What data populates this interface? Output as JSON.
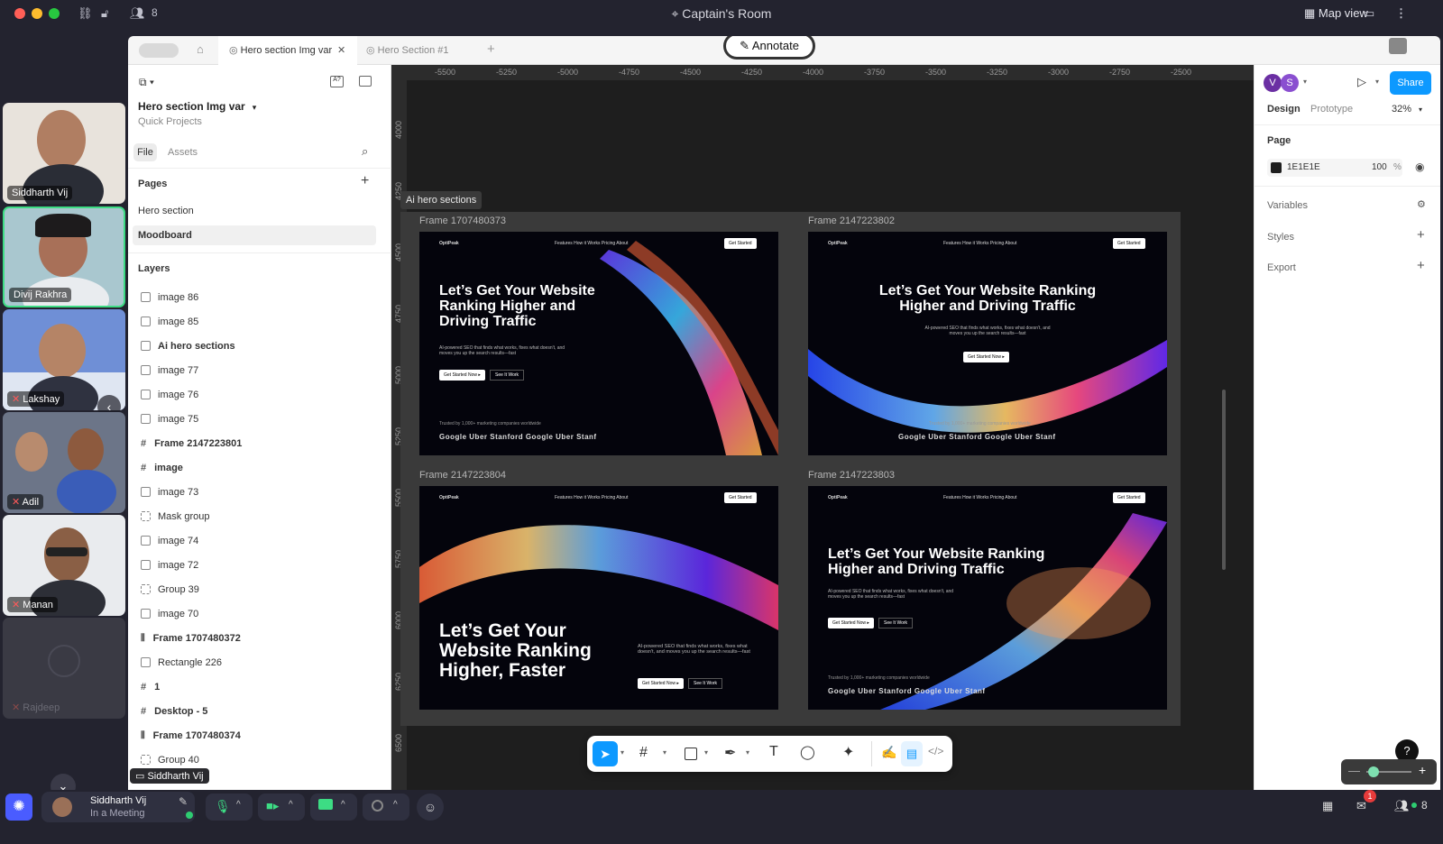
{
  "app": {
    "room_name": "Captain's Room",
    "participant_count": "8",
    "map_view_label": "Map view"
  },
  "participants": [
    {
      "name": "Siddharth Vij",
      "muted": false
    },
    {
      "name": "Divij Rakhra",
      "muted": false
    },
    {
      "name": "Lakshay",
      "muted": true
    },
    {
      "name": "Adil",
      "muted": true
    },
    {
      "name": "Manan",
      "muted": true
    },
    {
      "name": "Rajdeep",
      "muted": true
    }
  ],
  "tabs": [
    {
      "label": "Hero section Img var"
    },
    {
      "label": "Hero Section #1"
    }
  ],
  "annotate_label": "Annotate",
  "file": {
    "name": "Hero section Img var",
    "project": "Quick Projects",
    "tab_file": "File",
    "tab_assets": "Assets"
  },
  "pages": {
    "heading": "Pages",
    "items": [
      "Hero section",
      "Moodboard"
    ]
  },
  "layers": {
    "heading": "Layers",
    "items": [
      "image 86",
      "image 85",
      "Ai hero sections",
      "image 77",
      "image 76",
      "image 75",
      "Frame 2147223801",
      "image",
      "image 73",
      "Mask group",
      "image 74",
      "image 72",
      "Group 39",
      "image 70",
      "Frame 1707480372",
      "Rectangle 226",
      "1",
      "Desktop - 5",
      "Frame 1707480374",
      "Group 40"
    ]
  },
  "ruler_top": [
    "-5500",
    "-5250",
    "-5000",
    "-4750",
    "-4500",
    "-4250",
    "-4000",
    "-3750",
    "-3500",
    "-3250",
    "-3000",
    "-2750",
    "-2500"
  ],
  "ruler_left": [
    "4000",
    "4250",
    "4500",
    "4750",
    "5000",
    "5250",
    "5500",
    "5750",
    "6000",
    "6250",
    "6500"
  ],
  "section_label": "Ai hero sections",
  "frames": [
    {
      "name": "Frame 1707480373",
      "headline": "Let’s Get Your Website Ranking Higher and Driving Traffic",
      "sub": "AI-powered SEO that finds what works, fixes what doesn't, and moves you up the search results—fast",
      "cta": "Get Started Now ▸",
      "cta2": "See It Work",
      "brand": "OptiPeak",
      "cta_nav": "Get Started"
    },
    {
      "name": "Frame 2147223802",
      "headline": "Let’s Get Your Website Ranking Higher and Driving Traffic",
      "sub": "AI-powered SEO that finds what works, fixes what doesn't, and moves you up the search results—fast",
      "cta": "Get Started Now ▸",
      "brand": "OptiPeak",
      "cta_nav": "Get Started"
    },
    {
      "name": "Frame 2147223804",
      "headline": "Let’s Get Your Website Ranking Higher, Faster",
      "sub": "AI-powered SEO that finds what works, fixes what doesn't, and moves you up the search results—fast",
      "cta": "Get Started Now ▸",
      "cta2": "See It Work",
      "brand": "OptiPeak",
      "cta_nav": "Get Started"
    },
    {
      "name": "Frame 2147223803",
      "headline": "Let’s Get Your Website Ranking Higher and Driving Traffic",
      "sub": "AI-powered SEO that finds what works, fixes what doesn't, and moves you up the search results—fast",
      "cta": "Get Started Now ▸",
      "cta2": "See It Work",
      "brand": "OptiPeak",
      "cta_nav": "Get Started"
    }
  ],
  "nav_items": "Features   How it Works   Pricing   About",
  "trusted": "Trusted by 1,000+ marketing companies worldwide",
  "logos": "Google  Uber  Stanford  Google  Uber  Stanf",
  "right": {
    "tab_design": "Design",
    "tab_prototype": "Prototype",
    "zoom": "32%",
    "share": "Share",
    "page_heading": "Page",
    "page_color": "1E1E1E",
    "page_opacity": "100",
    "percent": "%",
    "variables": "Variables",
    "styles": "Styles",
    "export": "Export",
    "avatars": [
      "V",
      "S"
    ]
  },
  "bottom": {
    "user": "Siddharth Vij",
    "status": "In a Meeting",
    "notif_count": "1",
    "people": "8",
    "presenter": "Siddharth Vij"
  },
  "colors": {
    "figma_blue": "#0d99ff",
    "canvas": "#1e1e1e",
    "avatar_v": "#6b2fa3",
    "avatar_s": "#8a4fd0",
    "green": "#2ecc71"
  }
}
